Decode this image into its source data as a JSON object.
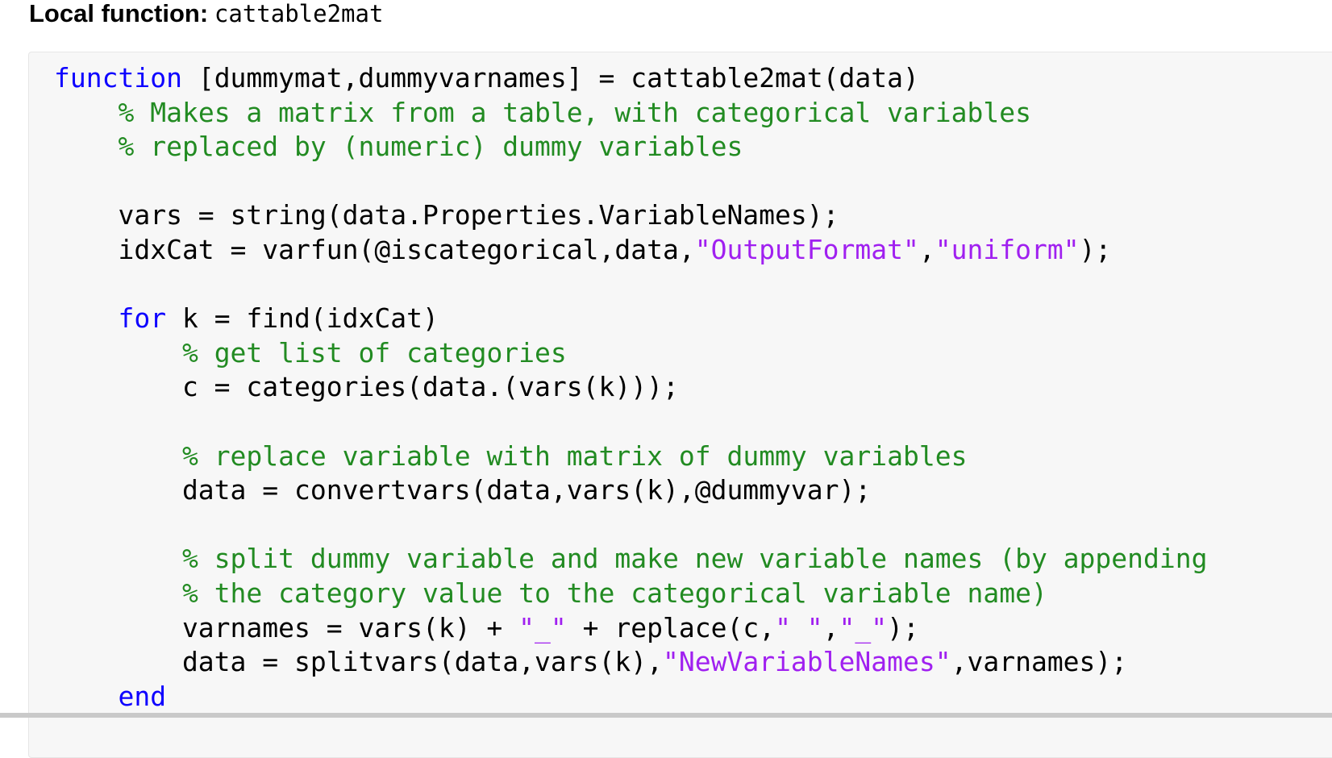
{
  "heading": {
    "label": "Local function:",
    "function_name": "cattable2mat"
  },
  "code": {
    "lines": [
      [
        {
          "t": "function",
          "c": "keyword"
        },
        {
          "t": " [dummymat,dummyvarnames] = cattable2mat(data)",
          "c": "plain"
        }
      ],
      [
        {
          "t": "    ",
          "c": "plain"
        },
        {
          "t": "% Makes a matrix from a table, with categorical variables",
          "c": "comment"
        }
      ],
      [
        {
          "t": "    ",
          "c": "plain"
        },
        {
          "t": "% replaced by (numeric) dummy variables",
          "c": "comment"
        }
      ],
      [],
      [
        {
          "t": "    vars = string(data.Properties.VariableNames);",
          "c": "plain"
        }
      ],
      [
        {
          "t": "    idxCat = varfun(@iscategorical,data,",
          "c": "plain"
        },
        {
          "t": "\"OutputFormat\"",
          "c": "string"
        },
        {
          "t": ",",
          "c": "plain"
        },
        {
          "t": "\"uniform\"",
          "c": "string"
        },
        {
          "t": ");",
          "c": "plain"
        }
      ],
      [],
      [
        {
          "t": "    ",
          "c": "plain"
        },
        {
          "t": "for",
          "c": "keyword"
        },
        {
          "t": " k = find(idxCat)",
          "c": "plain"
        }
      ],
      [
        {
          "t": "        ",
          "c": "plain"
        },
        {
          "t": "% get list of categories",
          "c": "comment"
        }
      ],
      [
        {
          "t": "        c = categories(data.(vars(k)));",
          "c": "plain"
        }
      ],
      [],
      [
        {
          "t": "        ",
          "c": "plain"
        },
        {
          "t": "% replace variable with matrix of dummy variables",
          "c": "comment"
        }
      ],
      [
        {
          "t": "        data = convertvars(data,vars(k),@dummyvar);",
          "c": "plain"
        }
      ],
      [],
      [
        {
          "t": "        ",
          "c": "plain"
        },
        {
          "t": "% split dummy variable and make new variable names (by appending",
          "c": "comment"
        }
      ],
      [
        {
          "t": "        ",
          "c": "plain"
        },
        {
          "t": "% the category value to the categorical variable name)",
          "c": "comment"
        }
      ],
      [
        {
          "t": "        varnames = vars(k) + ",
          "c": "plain"
        },
        {
          "t": "\"_\"",
          "c": "string"
        },
        {
          "t": " + replace(c,",
          "c": "plain"
        },
        {
          "t": "\" \"",
          "c": "string"
        },
        {
          "t": ",",
          "c": "plain"
        },
        {
          "t": "\"_\"",
          "c": "string"
        },
        {
          "t": ");",
          "c": "plain"
        }
      ],
      [
        {
          "t": "        data = splitvars(data,vars(k),",
          "c": "plain"
        },
        {
          "t": "\"NewVariableNames\"",
          "c": "string"
        },
        {
          "t": ",varnames);",
          "c": "plain"
        }
      ],
      [
        {
          "t": "    ",
          "c": "plain"
        },
        {
          "t": "end",
          "c": "keyword"
        }
      ]
    ]
  },
  "colors": {
    "keyword": "#0e00ff",
    "comment": "#228b22",
    "string": "#a020f0",
    "plain": "#000000",
    "code_background": "#f7f7f7"
  }
}
